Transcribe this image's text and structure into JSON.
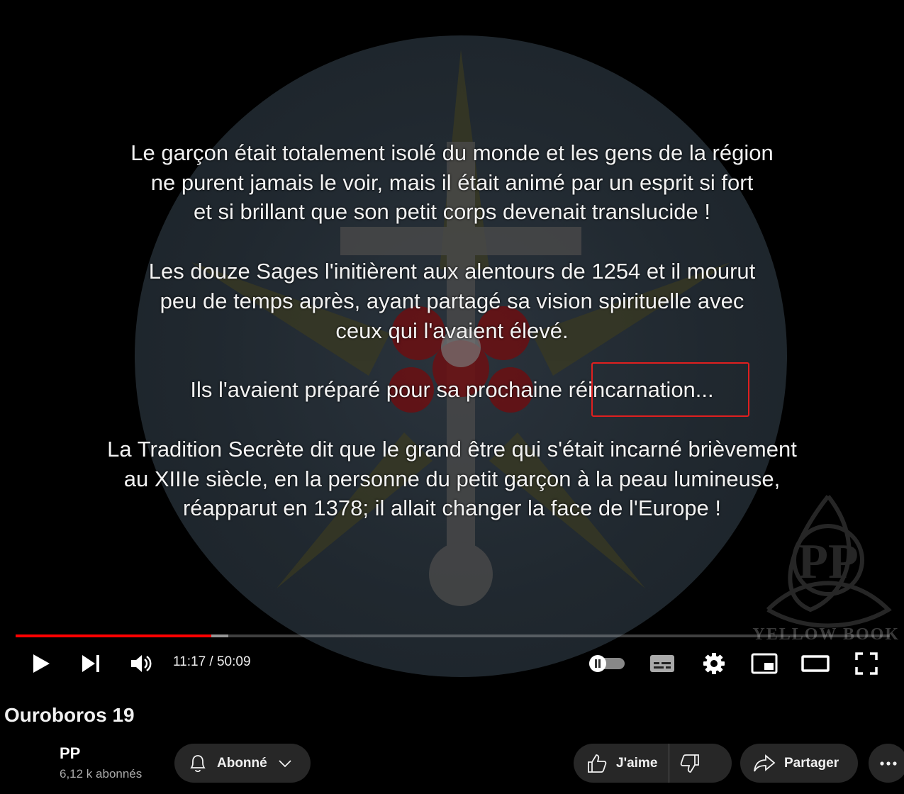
{
  "video": {
    "subtitles": [
      [
        "Le garçon était totalement isolé du monde et les gens de la région",
        "ne purent jamais le voir, mais il était animé par un esprit si fort",
        "et si brillant que son petit corps devenait translucide !"
      ],
      [
        "Les douze Sages l'initièrent aux alentours de 1254 et il mourut",
        "peu de temps après, ayant partagé sa vision spirituelle avec",
        "ceux qui l'avaient élevé."
      ],
      [
        "Ils l'avaient préparé pour sa prochaine réincarnation..."
      ],
      [
        "La Tradition Secrète dit que le grand être qui s'était incarné brièvement",
        "au XIIIe siècle, en la personne du petit garçon à la peau lumineuse,",
        "réapparut en 1378; il allait changer la face de l'Europe !"
      ]
    ],
    "watermark_text": "YELLOW BOOK",
    "progress": {
      "played_fraction": 0.2237,
      "buffered_fraction": 0.243
    },
    "time": "11:17 / 50:09",
    "colors": {
      "accent": "#ff0000",
      "highlight": "#e01f1f"
    }
  },
  "controls": {
    "icons": [
      "play-icon",
      "next-icon",
      "volume-icon",
      "autoplay-toggle",
      "subtitles-icon",
      "settings-icon",
      "miniplayer-icon",
      "theater-icon",
      "fullscreen-icon"
    ]
  },
  "title": "Ouroboros 19",
  "channel": {
    "name": "PP",
    "subscribers": "6,12 k abonnés"
  },
  "actions": {
    "subscribe_label": "Abonné",
    "like_label": "J'aime",
    "share_label": "Partager"
  }
}
